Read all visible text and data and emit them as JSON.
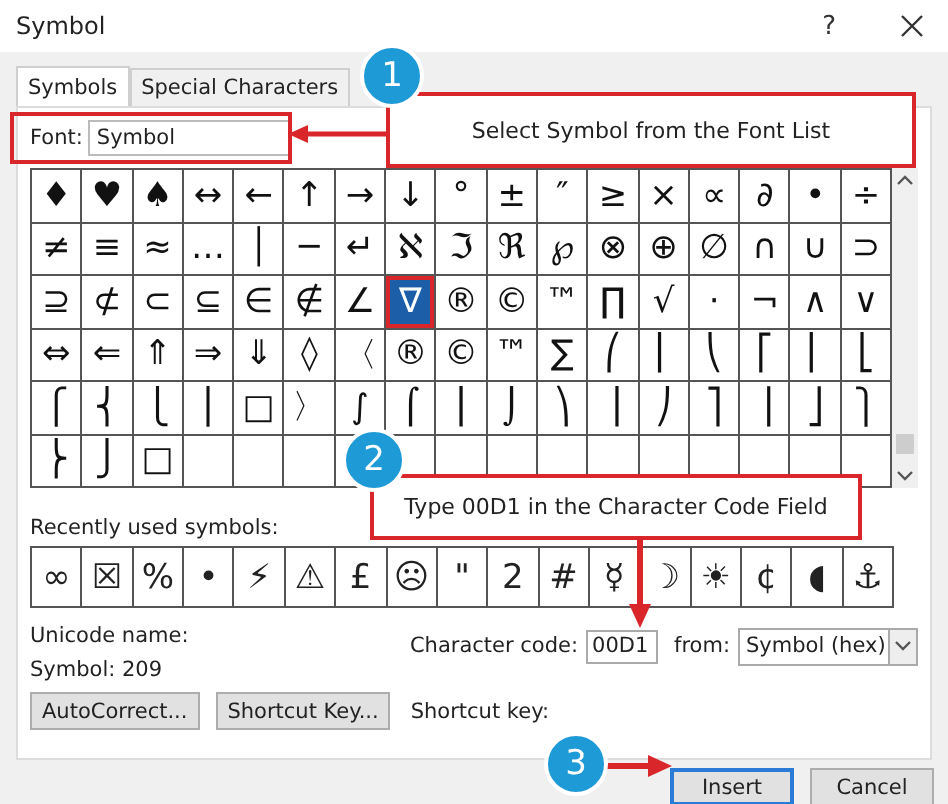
{
  "window": {
    "title": "Symbol",
    "help": "?"
  },
  "tabs": [
    {
      "label": "Symbols",
      "selected": true
    },
    {
      "label": "Special Characters",
      "selected": false
    }
  ],
  "font": {
    "label": "Font:",
    "value": "Symbol"
  },
  "symbol_grid": {
    "rows": [
      [
        {
          "c": "♦",
          "selected": false
        },
        {
          "c": "♥",
          "selected": false
        },
        {
          "c": "♠",
          "selected": false
        },
        {
          "c": "↔",
          "selected": false
        },
        {
          "c": "←",
          "selected": false
        },
        {
          "c": "↑",
          "selected": false
        },
        {
          "c": "→",
          "selected": false
        },
        {
          "c": "↓",
          "selected": false
        },
        {
          "c": "°",
          "selected": false
        },
        {
          "c": "±",
          "selected": false
        },
        {
          "c": "″",
          "selected": false
        },
        {
          "c": "≥",
          "selected": false
        },
        {
          "c": "×",
          "selected": false
        },
        {
          "c": "∝",
          "selected": false
        },
        {
          "c": "∂",
          "selected": false
        },
        {
          "c": "•",
          "selected": false
        },
        {
          "c": "÷",
          "selected": false
        }
      ],
      [
        {
          "c": "≠",
          "selected": false
        },
        {
          "c": "≡",
          "selected": false
        },
        {
          "c": "≈",
          "selected": false
        },
        {
          "c": "…",
          "selected": false
        },
        {
          "c": "│",
          "selected": false
        },
        {
          "c": "─",
          "selected": false
        },
        {
          "c": "↵",
          "selected": false
        },
        {
          "c": "ℵ",
          "selected": false
        },
        {
          "c": "ℑ",
          "selected": false
        },
        {
          "c": "ℜ",
          "selected": false
        },
        {
          "c": "℘",
          "selected": false
        },
        {
          "c": "⊗",
          "selected": false
        },
        {
          "c": "⊕",
          "selected": false
        },
        {
          "c": "∅",
          "selected": false
        },
        {
          "c": "∩",
          "selected": false
        },
        {
          "c": "∪",
          "selected": false
        },
        {
          "c": "⊃",
          "selected": false
        }
      ],
      [
        {
          "c": "⊇",
          "selected": false
        },
        {
          "c": "⊄",
          "selected": false
        },
        {
          "c": "⊂",
          "selected": false
        },
        {
          "c": "⊆",
          "selected": false
        },
        {
          "c": "∈",
          "selected": false
        },
        {
          "c": "∉",
          "selected": false
        },
        {
          "c": "∠",
          "selected": false
        },
        {
          "c": "∇",
          "selected": true
        },
        {
          "c": "®",
          "selected": false
        },
        {
          "c": "©",
          "selected": false
        },
        {
          "c": "™",
          "selected": false
        },
        {
          "c": "∏",
          "selected": false
        },
        {
          "c": "√",
          "selected": false
        },
        {
          "c": "⋅",
          "selected": false
        },
        {
          "c": "¬",
          "selected": false
        },
        {
          "c": "∧",
          "selected": false
        },
        {
          "c": "∨",
          "selected": false
        }
      ],
      [
        {
          "c": "⇔",
          "selected": false
        },
        {
          "c": "⇐",
          "selected": false
        },
        {
          "c": "⇑",
          "selected": false
        },
        {
          "c": "⇒",
          "selected": false
        },
        {
          "c": "⇓",
          "selected": false
        },
        {
          "c": "◊",
          "selected": false
        },
        {
          "c": "〈",
          "selected": false
        },
        {
          "c": "®",
          "selected": false
        },
        {
          "c": "©",
          "selected": false
        },
        {
          "c": "™",
          "selected": false
        },
        {
          "c": "∑",
          "selected": false
        },
        {
          "c": "⎛",
          "selected": false
        },
        {
          "c": "⎜",
          "selected": false
        },
        {
          "c": "⎝",
          "selected": false
        },
        {
          "c": "⎡",
          "selected": false
        },
        {
          "c": "⎢",
          "selected": false
        },
        {
          "c": "⎣",
          "selected": false
        }
      ],
      [
        {
          "c": "⎧",
          "selected": false
        },
        {
          "c": "⎨",
          "selected": false
        },
        {
          "c": "⎩",
          "selected": false
        },
        {
          "c": "⎪",
          "selected": false
        },
        {
          "c": "□",
          "selected": false
        },
        {
          "c": "〉",
          "selected": false
        },
        {
          "c": "∫",
          "selected": false
        },
        {
          "c": "⌠",
          "selected": false
        },
        {
          "c": "⎮",
          "selected": false
        },
        {
          "c": "⌡",
          "selected": false
        },
        {
          "c": "⎞",
          "selected": false
        },
        {
          "c": "⎟",
          "selected": false
        },
        {
          "c": "⎠",
          "selected": false
        },
        {
          "c": "⎤",
          "selected": false
        },
        {
          "c": "⎥",
          "selected": false
        },
        {
          "c": "⎦",
          "selected": false
        },
        {
          "c": "⎫",
          "selected": false
        }
      ],
      [
        {
          "c": "⎬",
          "selected": false
        },
        {
          "c": "⎭",
          "selected": false
        },
        {
          "c": "□",
          "selected": false
        }
      ]
    ]
  },
  "recent": {
    "label": "Recently used symbols:",
    "symbols": [
      "∞",
      "☒",
      "%",
      "•",
      "⚡",
      "⚠",
      "£",
      "☹",
      "\"",
      "2",
      "#",
      "☿",
      "☽",
      "☀",
      "¢",
      "◖",
      "⚓"
    ]
  },
  "unicode_name": {
    "label": "Unicode name:",
    "value": "Symbol: 209"
  },
  "character_code": {
    "label": "Character code:",
    "value": "00D1"
  },
  "from": {
    "label": "from:",
    "value": "Symbol (hex)"
  },
  "buttons": [
    "AutoCorrect...",
    "Shortcut Key..."
  ],
  "shortcut_key_label": "Shortcut key:",
  "footer_buttons": [
    {
      "label": "Insert",
      "focused": true
    },
    {
      "label": "Cancel",
      "focused": false
    }
  ],
  "callouts": [
    {
      "number": "1",
      "text": "Select Symbol from the Font List"
    },
    {
      "number": "2",
      "text": "Type 00D1 in the Character Code Field"
    },
    {
      "number": "3"
    }
  ]
}
